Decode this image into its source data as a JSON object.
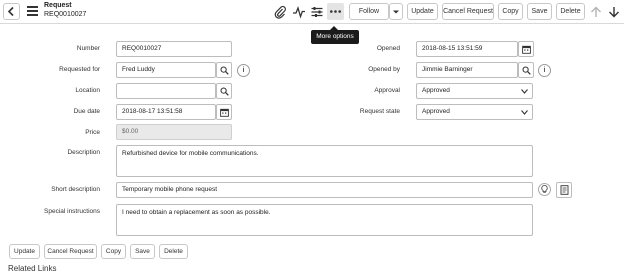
{
  "header": {
    "record_type": "Request",
    "record_number": "REQ0010027",
    "buttons": {
      "follow": "Follow",
      "update": "Update",
      "cancel_request": "Cancel Request",
      "copy": "Copy",
      "save": "Save",
      "delete": "Delete"
    },
    "tooltip": "More options"
  },
  "form": {
    "number": {
      "label": "Number",
      "value": "REQ0010027"
    },
    "requested_for": {
      "label": "Requested for",
      "value": "Fred Luddy"
    },
    "location": {
      "label": "Location",
      "value": ""
    },
    "due_date": {
      "label": "Due date",
      "value": "2018-08-17 13:51:58"
    },
    "price": {
      "label": "Price",
      "value": "$0.00"
    },
    "opened": {
      "label": "Opened",
      "value": "2018-08-15 13:51:59"
    },
    "opened_by": {
      "label": "Opened by",
      "value": "Jimmie Barninger"
    },
    "approval": {
      "label": "Approval",
      "value": "Approved"
    },
    "request_state": {
      "label": "Request state",
      "value": "Approved"
    },
    "description": {
      "label": "Description",
      "value": "Refurbished device for mobile communications."
    },
    "short_description": {
      "label": "Short description",
      "value": "Temporary mobile phone request"
    },
    "special_instructions": {
      "label": "Special instructions",
      "value": "I need to obtain a replacement as soon as possible."
    }
  },
  "footer_buttons": {
    "update": "Update",
    "cancel_request": "Cancel Request",
    "copy": "Copy",
    "save": "Save",
    "delete": "Delete"
  },
  "related_links": "Related Links",
  "icons": [
    "back-icon",
    "menu-icon",
    "attachment-icon",
    "activity-icon",
    "settings-icon",
    "more-options-icon",
    "chevron-down-icon",
    "arrow-up-icon",
    "arrow-down-icon",
    "search-icon",
    "info-icon",
    "calendar-icon",
    "lightbulb-icon",
    "document-icon"
  ]
}
